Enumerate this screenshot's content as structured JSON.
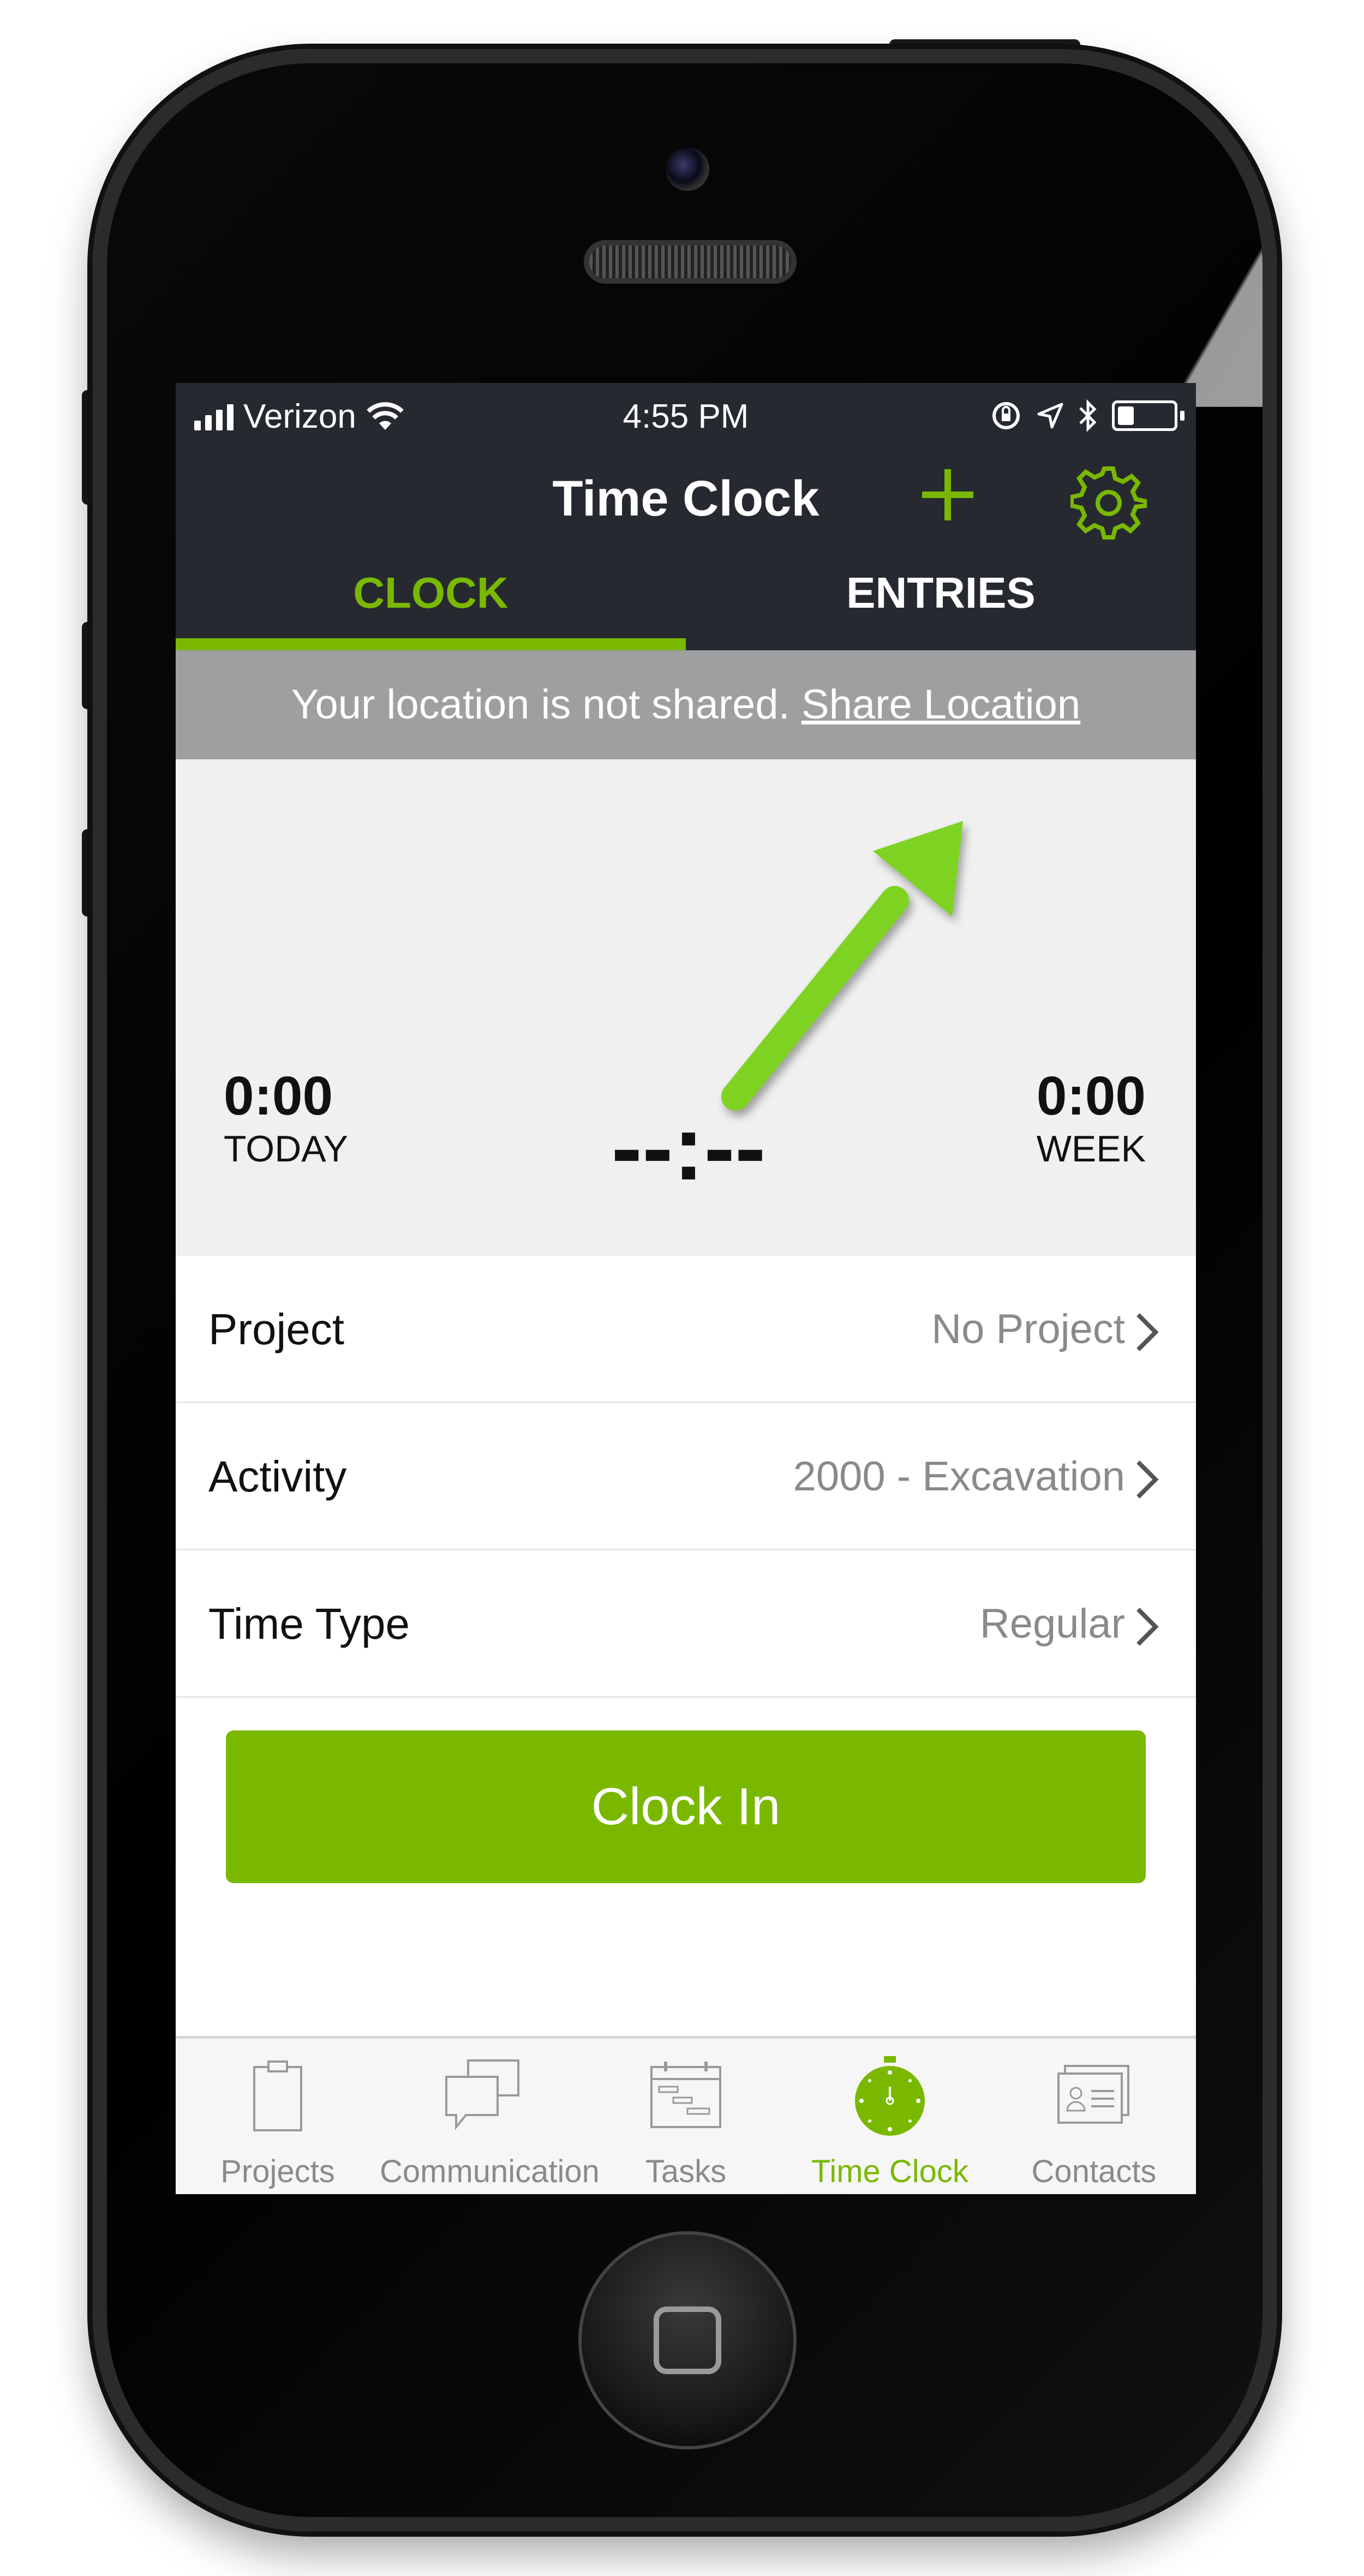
{
  "colors": {
    "accent": "#7ab800",
    "header_bg": "#262a30",
    "location_bar_bg": "#9e9fa1",
    "summary_bg": "#f0f0f0",
    "secondary_text": "#8a8a8a",
    "annotation_arrow": "#7ed321"
  },
  "status_bar": {
    "carrier": "Verizon",
    "time": "4:55 PM",
    "icons": [
      "signal-icon",
      "wifi-icon",
      "rotation-lock-icon",
      "location-arrow-icon",
      "bluetooth-icon",
      "battery-icon"
    ],
    "battery_level": 0.3
  },
  "header": {
    "title": "Time Clock",
    "add_icon": "plus-icon",
    "settings_icon": "gear-icon"
  },
  "tabs": [
    {
      "label": "CLOCK",
      "active": true
    },
    {
      "label": "ENTRIES",
      "active": false
    }
  ],
  "location_banner": {
    "message": "Your location is not shared.",
    "link": "Share Location"
  },
  "summary": {
    "today_value": "0:00",
    "today_label": "TODAY",
    "clock_display": "--:--",
    "week_value": "0:00",
    "week_label": "WEEK"
  },
  "fields": [
    {
      "label": "Project",
      "value": "No Project"
    },
    {
      "label": "Activity",
      "value": "2000 - Excavation"
    },
    {
      "label": "Time Type",
      "value": "Regular"
    }
  ],
  "clock_in_button": "Clock In",
  "tab_bar": [
    {
      "label": "Projects",
      "icon": "clipboard-icon",
      "active": false
    },
    {
      "label": "Communication",
      "icon": "chat-bubbles-icon",
      "active": false
    },
    {
      "label": "Tasks",
      "icon": "gantt-calendar-icon",
      "active": false
    },
    {
      "label": "Time Clock",
      "icon": "stopwatch-icon",
      "active": true
    },
    {
      "label": "Contacts",
      "icon": "contact-card-icon",
      "active": false
    }
  ]
}
